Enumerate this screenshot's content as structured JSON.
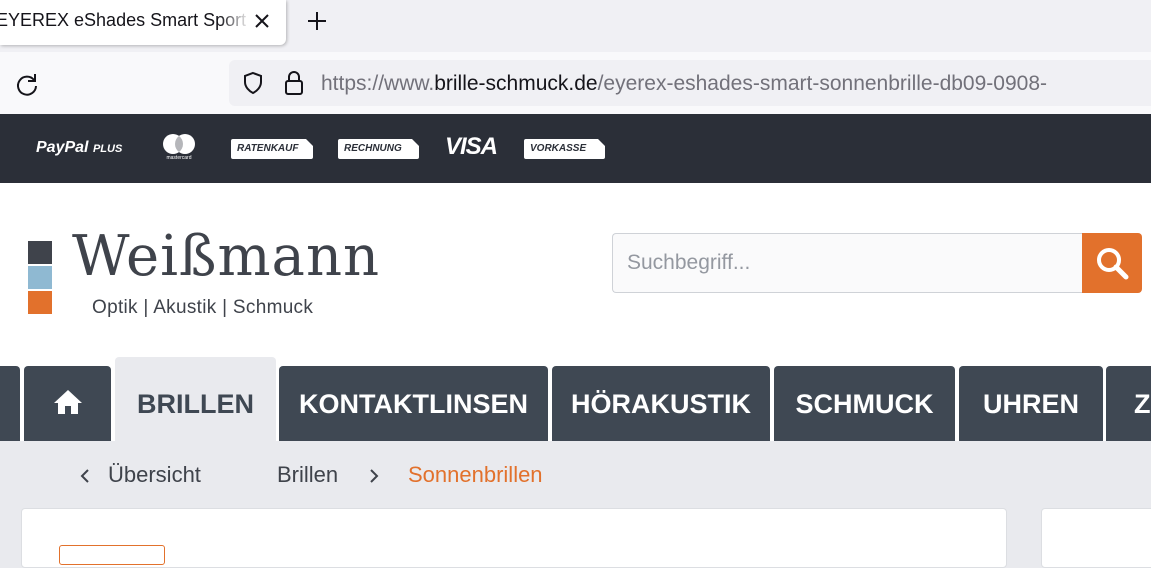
{
  "browser": {
    "tab_title": "EYEREX eShades Smart Sport Sonnenbrille",
    "url_prefix": "https://www.",
    "url_domain": "brille-schmuck.de",
    "url_path": "/eyerex-eshades-smart-sonnenbrille-db09-0908-"
  },
  "payment_bar": {
    "paypal": "PayPal",
    "paypal_suffix": "PLUS",
    "mastercard_text": "mastercard",
    "ratenkauf": "RATENKAUF",
    "rechnung": "RECHNUNG",
    "visa": "VISA",
    "vorkasse": "VORKASSE"
  },
  "logo": {
    "name": "Weißmann",
    "tagline": "Optik | Akustik | Schmuck",
    "colors": [
      "#3f434b",
      "#8fb9d2",
      "#e2712c"
    ]
  },
  "search": {
    "placeholder": "Suchbegriff..."
  },
  "nav": {
    "items": [
      "BRILLEN",
      "KONTAKTLINSEN",
      "HÖRAKUSTIK",
      "SCHMUCK",
      "UHREN",
      "Z"
    ]
  },
  "breadcrumb": {
    "back": "Übersicht",
    "parent": "Brillen",
    "current": "Sonnenbrillen"
  },
  "colors": {
    "accent": "#e2712c",
    "nav_bg": "#3f4853",
    "paybar_bg": "#2b2f38"
  }
}
